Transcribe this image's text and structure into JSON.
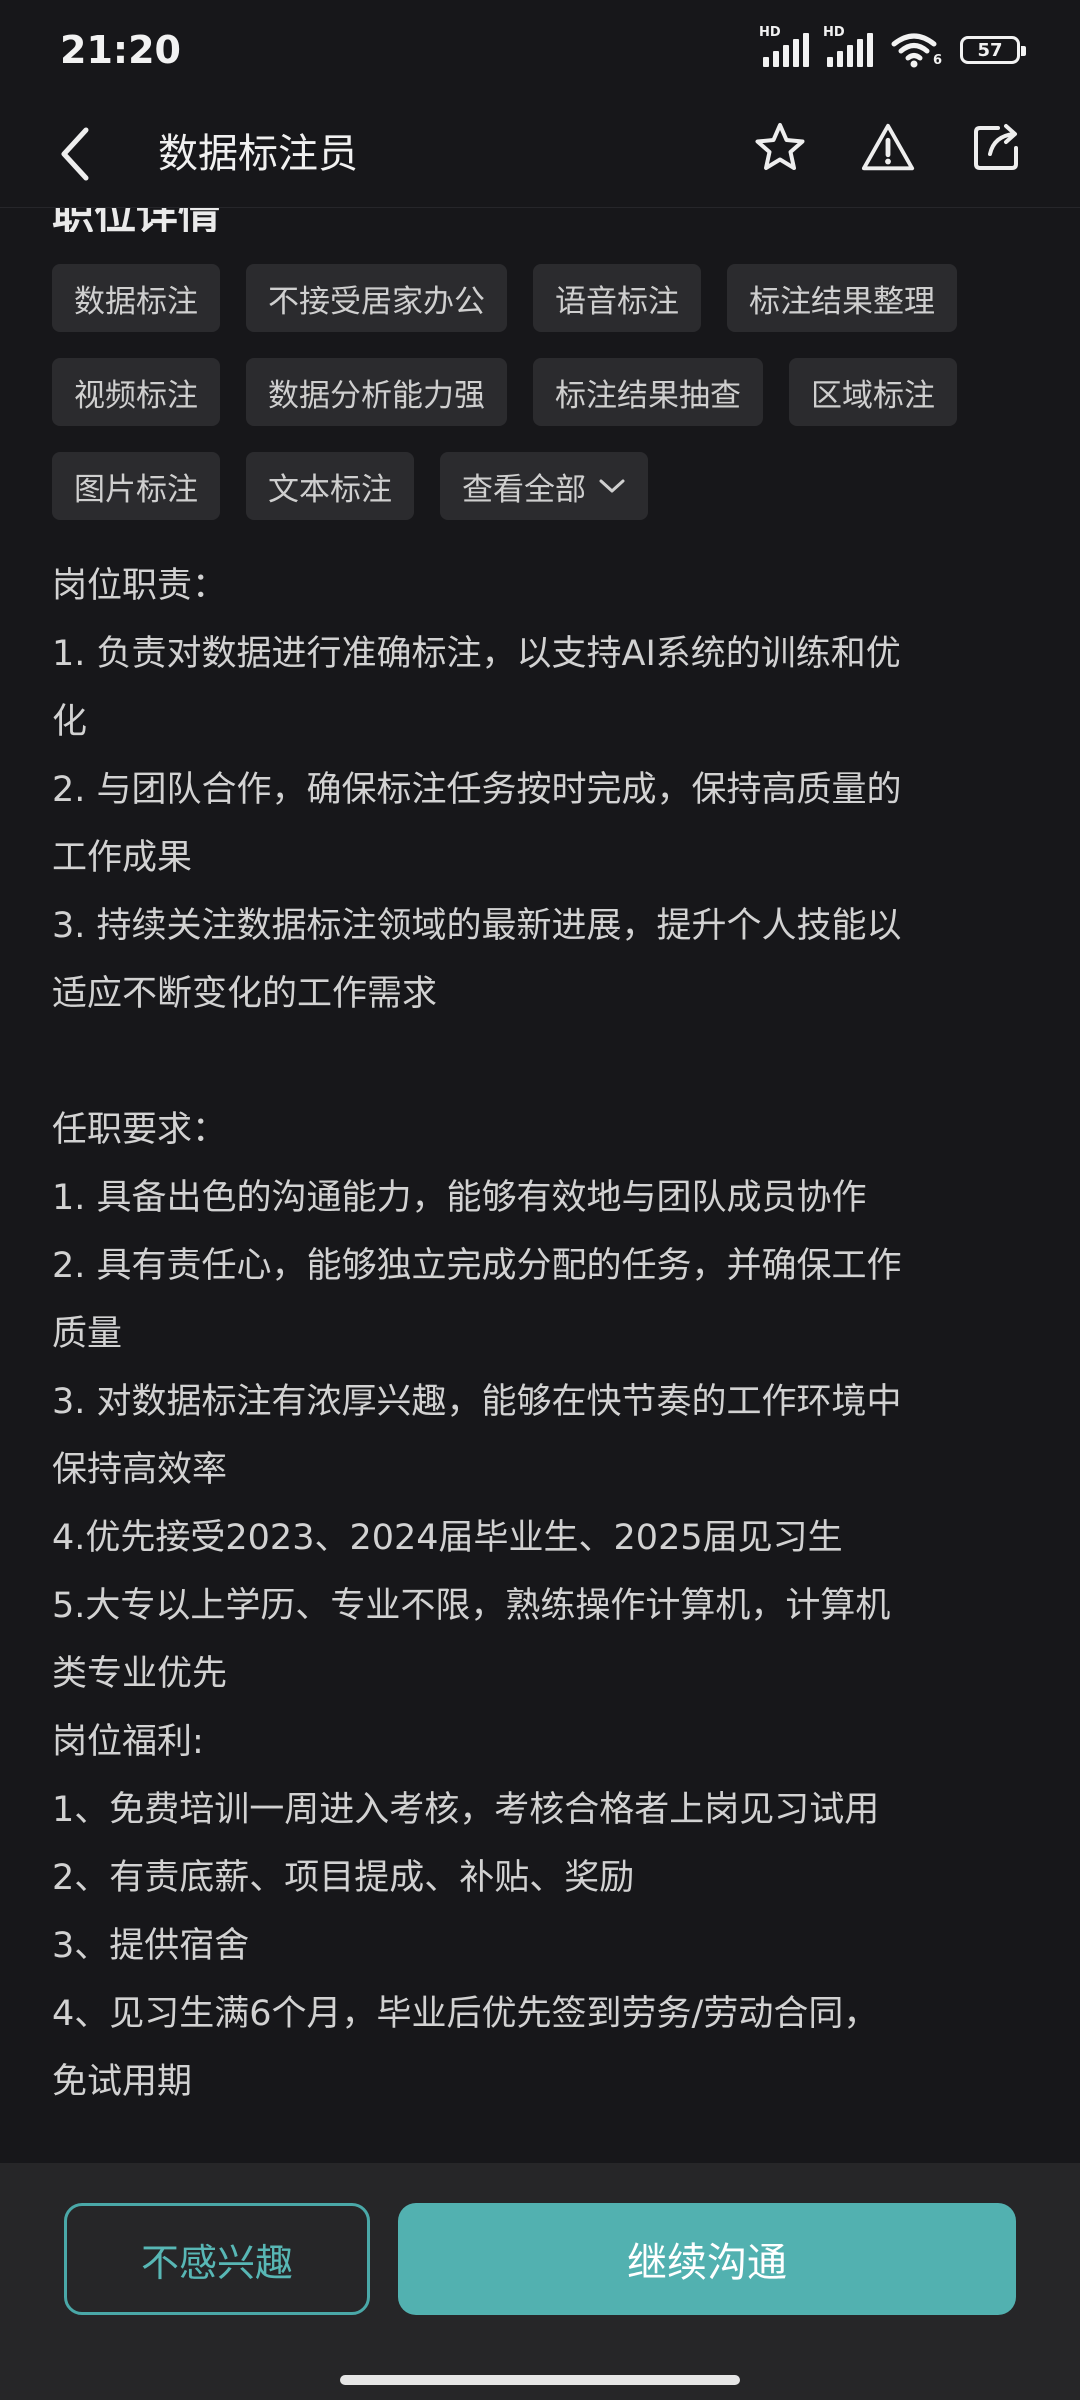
{
  "status_bar": {
    "time": "21:20",
    "hd1": "HD",
    "hd2": "HD",
    "wifi_sub": "6",
    "battery": "57"
  },
  "header": {
    "title": "数据标注员",
    "icons": [
      "back-icon",
      "star-icon",
      "warning-icon",
      "share-icon"
    ]
  },
  "section": {
    "title": "职位详情"
  },
  "tags": {
    "row1": [
      "数据标注",
      "不接受居家办公",
      "语音标注",
      "标注结果整理"
    ],
    "row2": [
      "视频标注",
      "数据分析能力强",
      "标注结果抽查",
      "区域标注"
    ],
    "row3": [
      "图片标注",
      "文本标注"
    ],
    "view_all": "查看全部"
  },
  "description": {
    "duties_title": "岗位职责：",
    "duties": [
      "1. 负责对数据进行准确标注，以支持AI系统的训练和优",
      "化",
      "2. 与团队合作，确保标注任务按时完成，保持高质量的",
      "工作成果",
      "3. 持续关注数据标注领域的最新进展，提升个人技能以",
      "适应不断变化的工作需求"
    ],
    "req_title": "任职要求：",
    "requirements": [
      "1. 具备出色的沟通能力，能够有效地与团队成员协作",
      "2. 具有责任心，能够独立完成分配的任务，并确保工作",
      "质量",
      "3. 对数据标注有浓厚兴趣，能够在快节奏的工作环境中",
      "保持高效率",
      "4.优先接受2023、2024届毕业生、2025届见习生",
      "5.大专以上学历、专业不限，熟练操作计算机，计算机",
      "类专业优先"
    ],
    "benefits_title": "岗位福利:",
    "benefits": [
      "1、免费培训一周进入考核，考核合格者上岗见习试用",
      "2、有责底薪、项目提成、补贴、奖励",
      "3、提供宿舍",
      "4、见习生满6个月，毕业后优先签到劳务/劳动合同，",
      "免试用期"
    ]
  },
  "actions": {
    "not_interested": "不感兴趣",
    "continue": "继续沟通"
  },
  "colors": {
    "accent": "#52b1b0",
    "background": "#17171a",
    "tag_bg": "#2b2b2e"
  }
}
